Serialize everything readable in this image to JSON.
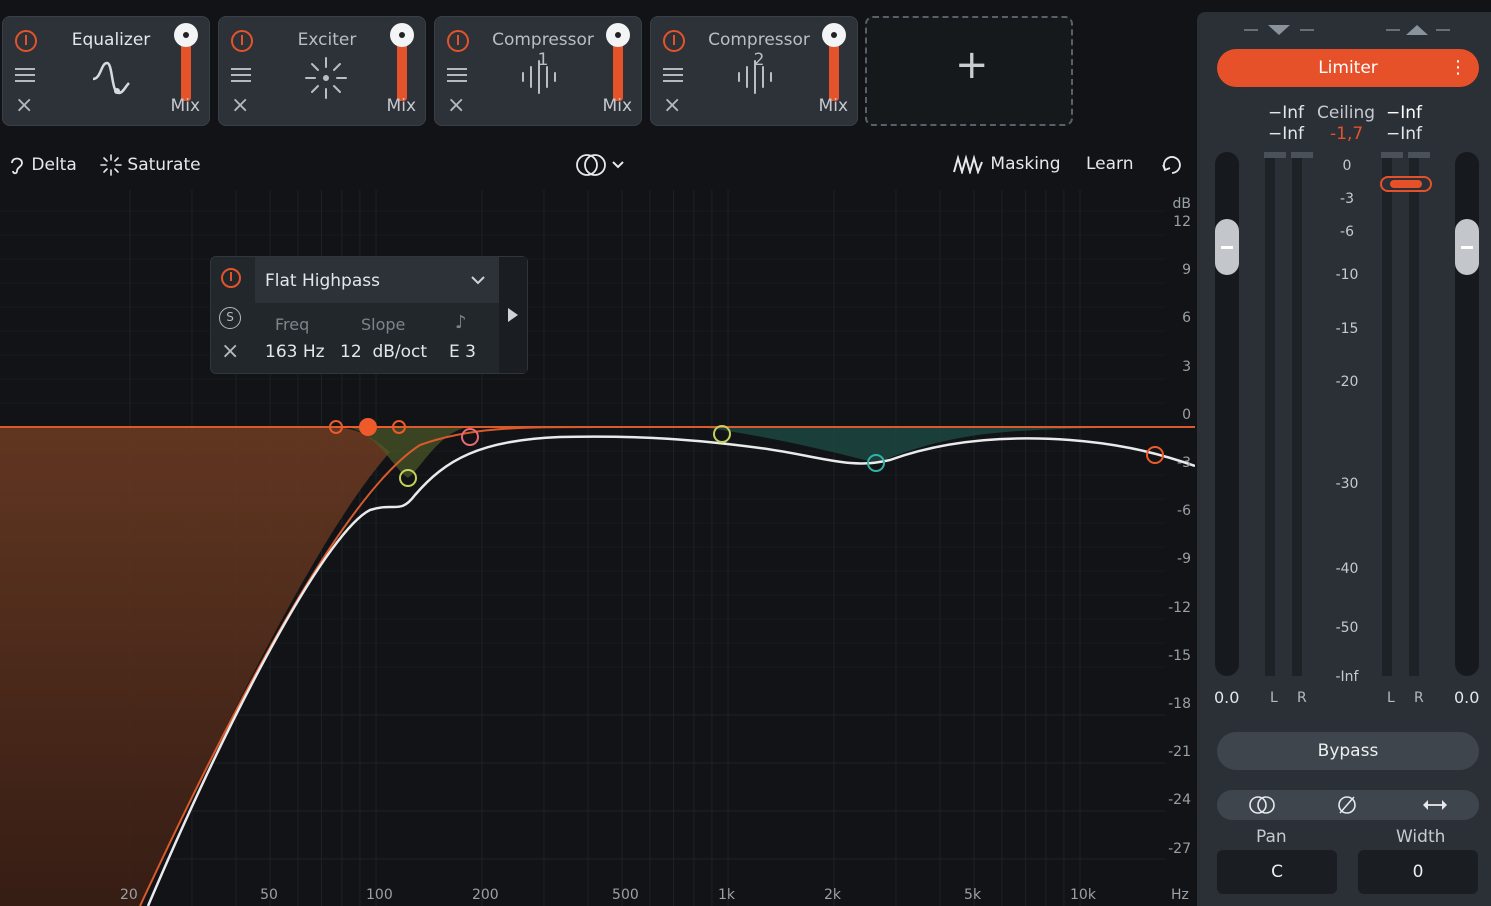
{
  "modules": [
    {
      "name": "Equalizer",
      "mix": "Mix"
    },
    {
      "name": "Exciter",
      "mix": "Mix"
    },
    {
      "name": "Compressor 1",
      "mix": "Mix"
    },
    {
      "name": "Compressor 2",
      "mix": "Mix"
    }
  ],
  "add_module": "+",
  "toolbar": {
    "delta": "Delta",
    "saturate": "Saturate",
    "masking": "Masking",
    "learn": "Learn"
  },
  "band": {
    "type": "Flat Highpass",
    "solo": "S",
    "freq_label": "Freq",
    "slope_label": "Slope",
    "freq_value": "163 Hz",
    "slope_value": "12  dB/oct",
    "note_value": "E 3"
  },
  "db_axis": {
    "unit": "dB",
    "ticks": [
      "12",
      "9",
      "6",
      "3",
      "0",
      "-3",
      "-6",
      "-9",
      "-12",
      "-15",
      "-18",
      "-21",
      "-24",
      "-27"
    ]
  },
  "hz_axis": {
    "unit": "Hz",
    "ticks": [
      "20",
      "50",
      "100",
      "200",
      "500",
      "1k",
      "2k",
      "5k",
      "10k"
    ]
  },
  "limiter": {
    "title": "Limiter",
    "peak_left_1": "−Inf",
    "peak_left_2": "−Inf",
    "ceiling_label": "Ceiling",
    "ceiling_value": "-1,7",
    "peak_right_1": "−Inf",
    "peak_right_2": "−Inf",
    "scale": [
      "0",
      "-3",
      "-6",
      "-10",
      "-15",
      "-20",
      "-30",
      "-40",
      "-50",
      "-Inf"
    ],
    "left_value": "0.0",
    "right_value": "0.0",
    "l": "L",
    "r": "R",
    "bypass": "Bypass",
    "pan_label": "Pan",
    "width_label": "Width",
    "pan_value": "C",
    "width_value": "0"
  },
  "colors": {
    "accent": "#e6512a",
    "yellow_node": "#c6d05a",
    "teal_node": "#2fb3a6",
    "pink_node": "#e76a73"
  }
}
